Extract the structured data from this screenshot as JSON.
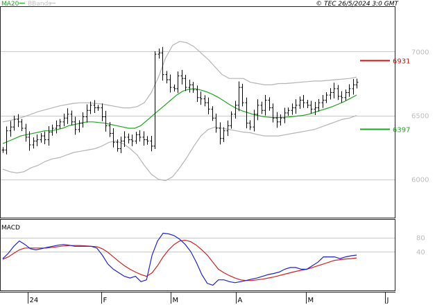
{
  "header": {
    "legend_ma": "MA20",
    "legend_bbands": "BBands",
    "copyright": "© TEC 26/5/2024 3:0 GMT"
  },
  "colors": {
    "ma": "#1fa51f",
    "bbands": "#b4b4b4",
    "price": "#000000",
    "macd": "#1f1fcf",
    "signal": "#cf1f1f",
    "resistance": "#c81414",
    "support": "#1fa51f",
    "grid": "#c8c8c8",
    "tick_label": "#bdbdbd"
  },
  "chart_data": [
    {
      "type": "ohlc",
      "y_ticks": [
        6000,
        6500,
        7000
      ],
      "y_tick_labels": [
        "6000",
        "6500",
        "7000"
      ],
      "ylim": [
        5700,
        7350
      ],
      "x_tick_labels": [
        "24",
        "F",
        "M",
        "A",
        "M",
        "J"
      ],
      "levels": [
        {
          "label": "6931",
          "value": 6931,
          "kind": "resistance"
        },
        {
          "label": "6397",
          "value": 6397,
          "kind": "support"
        }
      ],
      "series_price_close": [
        6230,
        6380,
        6410,
        6470,
        6450,
        6400,
        6330,
        6270,
        6300,
        6310,
        6340,
        6310,
        6370,
        6400,
        6420,
        6450,
        6480,
        6510,
        6450,
        6390,
        6440,
        6490,
        6540,
        6580,
        6560,
        6560,
        6490,
        6420,
        6360,
        6290,
        6240,
        6300,
        6330,
        6310,
        6300,
        6350,
        6330,
        6310,
        6300,
        6260,
        6980,
        6990,
        6820,
        6780,
        6720,
        6710,
        6810,
        6790,
        6720,
        6740,
        6700,
        6640,
        6630,
        6600,
        6550,
        6480,
        6400,
        6320,
        6380,
        6420,
        6510,
        6580,
        6720,
        6600,
        6440,
        6410,
        6510,
        6580,
        6540,
        6620,
        6560,
        6480,
        6450,
        6480,
        6520,
        6540,
        6560,
        6580,
        6620,
        6600,
        6580,
        6550,
        6560,
        6600,
        6620,
        6660,
        6680,
        6710,
        6650,
        6640,
        6680,
        6710,
        6740,
        6760
      ],
      "series_ma20": [
        6280,
        6300,
        6320,
        6340,
        6350,
        6360,
        6370,
        6380,
        6380,
        6390,
        6400,
        6420,
        6430,
        6440,
        6450,
        6450,
        6445,
        6440,
        6430,
        6420,
        6410,
        6400,
        6400,
        6420,
        6460,
        6500,
        6540,
        6580,
        6620,
        6660,
        6690,
        6705,
        6710,
        6700,
        6685,
        6665,
        6640,
        6610,
        6580,
        6555,
        6535,
        6520,
        6505,
        6495,
        6488,
        6484,
        6484,
        6486,
        6490,
        6495,
        6500,
        6510,
        6525,
        6540,
        6555,
        6570,
        6590,
        6610,
        6635,
        6660
      ],
      "series_bb_upper": [
        6450,
        6460,
        6475,
        6490,
        6510,
        6530,
        6545,
        6560,
        6575,
        6585,
        6595,
        6600,
        6600,
        6595,
        6590,
        6580,
        6570,
        6560,
        6560,
        6570,
        6600,
        6680,
        6800,
        6950,
        7050,
        7080,
        7070,
        7040,
        6990,
        6940,
        6880,
        6820,
        6790,
        6790,
        6790,
        6760,
        6750,
        6740,
        6740,
        6750,
        6750,
        6755,
        6760,
        6765,
        6770,
        6770,
        6775,
        6780,
        6785,
        6790,
        6800
      ],
      "series_bb_lower": [
        6080,
        6060,
        6050,
        6060,
        6090,
        6110,
        6140,
        6160,
        6170,
        6190,
        6210,
        6220,
        6230,
        6240,
        6260,
        6290,
        6300,
        6280,
        6240,
        6190,
        6110,
        6040,
        6000,
        5990,
        6020,
        6090,
        6170,
        6260,
        6340,
        6390,
        6410,
        6400,
        6390,
        6380,
        6370,
        6365,
        6350,
        6340,
        6340,
        6340,
        6350,
        6360,
        6370,
        6380,
        6390,
        6410,
        6430,
        6450,
        6470,
        6480,
        6500
      ]
    },
    {
      "type": "line",
      "title": "MACD",
      "y_ticks": [
        40,
        80
      ],
      "y_tick_labels": [
        "40",
        "80"
      ],
      "ylim": [
        -70,
        130
      ],
      "series": [
        {
          "values": [
            20,
            35,
            55,
            70,
            60,
            48,
            45,
            48,
            52,
            55,
            58,
            60,
            58,
            55,
            55,
            55,
            55,
            50,
            30,
            5,
            -10,
            -20,
            -30,
            -35,
            -30,
            -45,
            -40,
            30,
            70,
            92,
            90,
            85,
            75,
            60,
            40,
            10,
            -25,
            -50,
            -55,
            -40,
            -40,
            -45,
            -48,
            -45,
            -42,
            -38,
            -35,
            -30,
            -25,
            -22,
            -18,
            -10,
            -5,
            -5,
            -10,
            -10,
            0,
            10,
            25,
            25,
            25,
            20,
            25,
            28,
            30
          ]
        },
        {
          "values": [
            18,
            25,
            35,
            45,
            50,
            50,
            50,
            50,
            50,
            52,
            54,
            56,
            57,
            57,
            57,
            56,
            55,
            54,
            48,
            38,
            25,
            12,
            0,
            -10,
            -18,
            -25,
            -30,
            -20,
            0,
            25,
            45,
            60,
            70,
            72,
            68,
            58,
            45,
            30,
            10,
            -10,
            -20,
            -28,
            -35,
            -40,
            -42,
            -42,
            -40,
            -38,
            -35,
            -32,
            -28,
            -24,
            -20,
            -16,
            -13,
            -10,
            -5,
            0,
            5,
            10,
            15,
            17,
            19,
            20,
            22
          ]
        }
      ]
    }
  ]
}
